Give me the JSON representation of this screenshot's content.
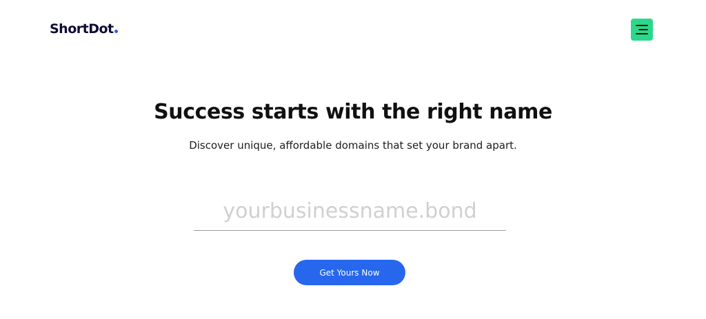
{
  "header": {
    "logo_text": "ShortDot",
    "menu_icon": "hamburger-menu-icon"
  },
  "hero": {
    "title": "Success starts with the right name",
    "subtitle": "Discover unique, affordable domains that set your brand apart."
  },
  "search": {
    "value": "",
    "placeholder": "yourbusinessname.bond"
  },
  "cta": {
    "label": "Get Yours Now"
  },
  "colors": {
    "logo_text": "#0e0b33",
    "logo_dot": "#2c62ea",
    "menu_bg": "#2bd88a",
    "menu_lines": "#0e1a14",
    "cta_bg": "#2667ee",
    "cta_text": "#ffffff"
  }
}
